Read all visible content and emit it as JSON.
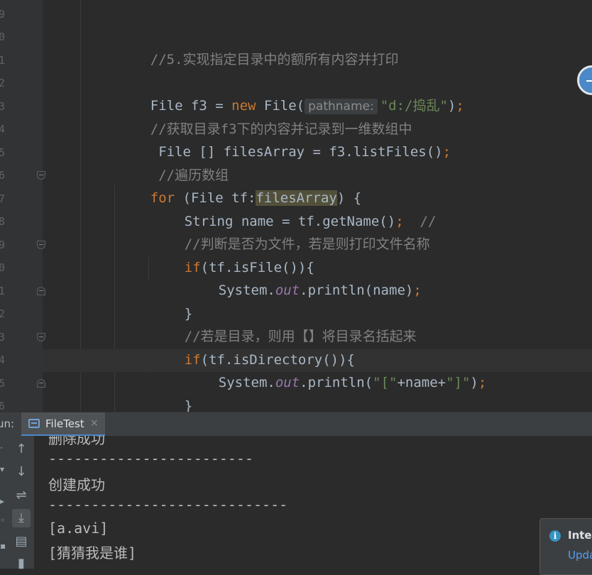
{
  "gutter": {
    "line_numbers": [
      "9",
      "0",
      "1",
      "2",
      "3",
      "4",
      "5",
      "6",
      "7",
      "8",
      "9",
      "0",
      "1",
      "2",
      "3",
      "4",
      "5",
      "6"
    ]
  },
  "code_lines": [
    {
      "comment": "//5.实现指定目录中的额所有内容并打印"
    },
    {
      "t1": "File f3 = ",
      "kw_new": "new",
      "t2": " File(",
      "hint": "pathname:",
      "str": "\"d:/捣乱\"",
      "t3": ")",
      "semi": ";"
    },
    {
      "comment": "//获取目录f3下的内容并记录到一维数组中"
    },
    {
      "text": " File [] filesArray = f3.listFiles()",
      "semi": ";"
    },
    {
      "comment": " //遍历数组"
    },
    {
      "kw_for": "for",
      "t1": " (File tf:",
      "hl": "filesArray",
      "t2": ") {"
    },
    {
      "text": "String name = tf.getName()",
      "semi": ";",
      "cmt": "  //"
    },
    {
      "comment": "//判断是否为文件，若是则打印文件名称"
    },
    {
      "kw_if": "if",
      "text": "(tf.isFile()){"
    },
    {
      "t1": "System.",
      "fld": "out",
      "t2": ".println(name)",
      "semi": ";"
    },
    {
      "text": "}"
    },
    {
      "comment": "//若是目录，则用【】将目录名括起来"
    },
    {
      "kw_if": "if",
      "text": "(tf.isDirectory()){"
    },
    {
      "t1": "System.",
      "fld": "out",
      "t2": ".println(",
      "s1": "\"[\"",
      "t3": "+name+",
      "s2": "\"]\"",
      "t4": ")",
      "semi": ";"
    },
    {
      "text": "}"
    }
  ],
  "run_panel": {
    "label": "un:",
    "tab_label": "FileTest",
    "close_glyph": "×"
  },
  "toolbar_icons": [
    "up-arrow-icon",
    "down-arrow-icon",
    "soft-wrap-icon",
    "scroll-to-end-icon",
    "print-icon",
    "trash-icon"
  ],
  "console_lines": [
    "删除成功",
    "------------------------",
    "创建成功",
    "----------------------------",
    "[a.avi]",
    "[猜猜我是谁]"
  ],
  "notification": {
    "title": "Intel",
    "link": "Upda"
  },
  "colors": {
    "editor_bg": "#2b2b2b",
    "gutter_bg": "#313335",
    "keyword": "#cc7832",
    "string": "#6a8759",
    "comment": "#808080",
    "field": "#9876aa",
    "accent": "#4a88c7"
  }
}
